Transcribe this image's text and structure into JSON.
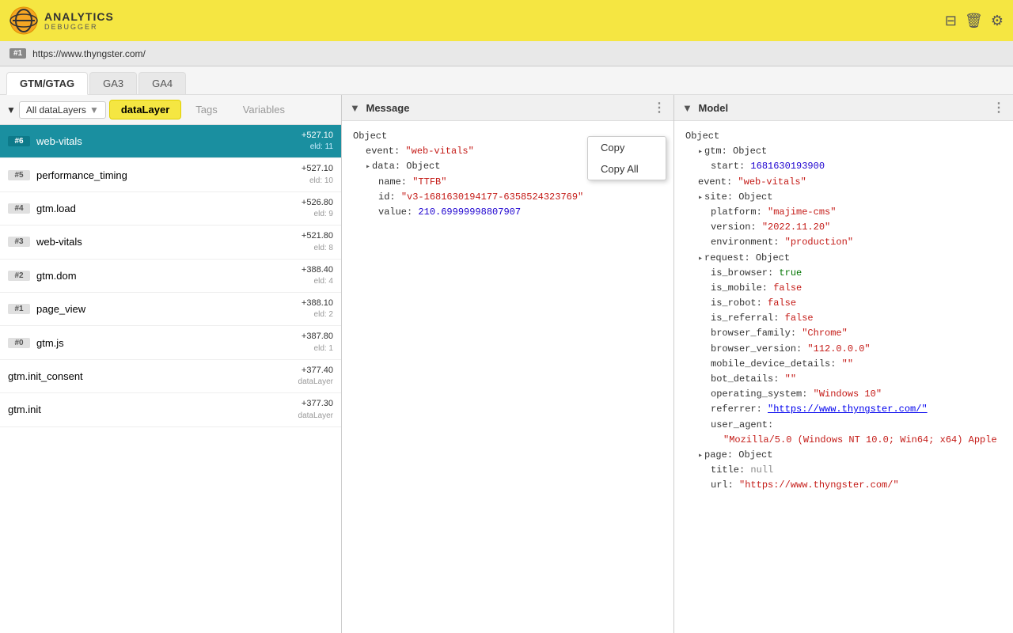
{
  "header": {
    "logo_title": "ANALYTICS",
    "logo_sub": "DEBUGGER",
    "icons": [
      "barcode-icon",
      "cup-icon",
      "settings-icon"
    ]
  },
  "url_bar": {
    "badge": "#1",
    "url": "https://www.thyngster.com/"
  },
  "tabs": [
    {
      "label": "GTM/GTAG",
      "active": true
    },
    {
      "label": "GA3",
      "active": false
    },
    {
      "label": "GA4",
      "active": false
    }
  ],
  "filter": {
    "arrow": "▼",
    "dropdown_label": "All dataLayers",
    "tabs": [
      "dataLayer",
      "Tags",
      "Variables"
    ]
  },
  "events": [
    {
      "badge": "#6",
      "name": "web-vitals",
      "time": "+527.10",
      "eid": "eld: 11",
      "selected": true
    },
    {
      "badge": "#5",
      "name": "performance_timing",
      "time": "+527.10",
      "eid": "eld: 10",
      "selected": false
    },
    {
      "badge": "#4",
      "name": "gtm.load",
      "time": "+526.80",
      "eid": "eld: 9",
      "selected": false
    },
    {
      "badge": "#3",
      "name": "web-vitals",
      "time": "+521.80",
      "eid": "eld: 8",
      "selected": false
    },
    {
      "badge": "#2",
      "name": "gtm.dom",
      "time": "+388.40",
      "eid": "eld: 4",
      "selected": false
    },
    {
      "badge": "#1",
      "name": "page_view",
      "time": "+388.10",
      "eid": "eld: 2",
      "selected": false
    },
    {
      "badge": "#0",
      "name": "gtm.js",
      "time": "+387.80",
      "eid": "eld: 1",
      "selected": false
    },
    {
      "badge": "",
      "name": "gtm.init_consent",
      "time": "+377.40",
      "eid": "dataLayer",
      "selected": false
    },
    {
      "badge": "",
      "name": "gtm.init",
      "time": "+377.30",
      "eid": "dataLayer",
      "selected": false
    }
  ],
  "message_panel": {
    "title": "Message",
    "content": {
      "root": "Object",
      "event_key": "event:",
      "event_value": "\"web-vitals\"",
      "data_key": "data:",
      "data_type": "Object",
      "name_key": "name:",
      "name_value": "\"TTFB\"",
      "id_key": "id:",
      "id_value": "\"v3-1681630194177-6358524323769\"",
      "value_key": "value:",
      "value_number": "210.69999998807907"
    }
  },
  "context_menu": {
    "items": [
      "Copy",
      "Copy All"
    ]
  },
  "model_panel": {
    "title": "Model",
    "content": {
      "root": "Object",
      "gtm_key": "gtm:",
      "gtm_type": "Object",
      "gtm_start_key": "start:",
      "gtm_start_value": "1681630193900",
      "event_key": "event:",
      "event_value": "\"web-vitals\"",
      "site_key": "site:",
      "site_type": "Object",
      "platform_key": "platform:",
      "platform_value": "\"majime-cms\"",
      "version_key": "version:",
      "version_value": "\"2022.11.20\"",
      "environment_key": "environment:",
      "environment_value": "\"production\"",
      "request_key": "request:",
      "request_type": "Object",
      "is_browser_key": "is_browser:",
      "is_browser_value": "true",
      "is_mobile_key": "is_mobile:",
      "is_mobile_value": "false",
      "is_robot_key": "is_robot:",
      "is_robot_value": "false",
      "is_referral_key": "is_referral:",
      "is_referral_value": "false",
      "browser_family_key": "browser_family:",
      "browser_family_value": "\"Chrome\"",
      "browser_version_key": "browser_version:",
      "browser_version_value": "\"112.0.0.0\"",
      "mobile_device_key": "mobile_device_details:",
      "mobile_device_value": "\"\"",
      "bot_details_key": "bot_details:",
      "bot_details_value": "\"\"",
      "os_key": "operating_system:",
      "os_value": "\"Windows 10\"",
      "referrer_key": "referrer:",
      "referrer_value": "\"https://www.thyngster.com/\"",
      "user_agent_key": "user_agent:",
      "user_agent_value": "\"Mozilla/5.0 (Windows NT 10.0; Win64; x64) Apple",
      "page_key": "page:",
      "page_type": "Object",
      "title_key": "title:",
      "title_value": "null",
      "url_key": "url:",
      "url_value": "\"https://www.thyngster.com/\""
    }
  }
}
